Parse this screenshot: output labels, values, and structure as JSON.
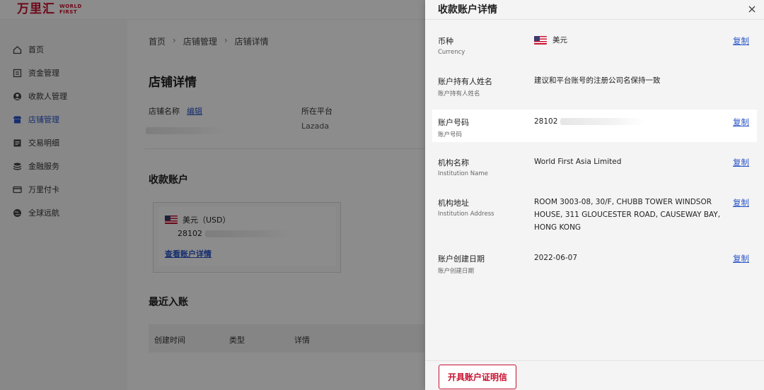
{
  "logo": {
    "cn": "万里汇",
    "en_line1": "WORLD",
    "en_line2": "FIRST"
  },
  "sidebar": {
    "items": [
      {
        "label": "首页",
        "icon": "home-icon",
        "active": false
      },
      {
        "label": "资金管理",
        "icon": "fund-icon",
        "active": false
      },
      {
        "label": "收款人管理",
        "icon": "payee-icon",
        "active": false
      },
      {
        "label": "店铺管理",
        "icon": "store-icon",
        "active": true
      },
      {
        "label": "交易明细",
        "icon": "transactions-icon",
        "active": false
      },
      {
        "label": "金融服务",
        "icon": "finance-icon",
        "active": false
      },
      {
        "label": "万里付卡",
        "icon": "card-icon",
        "active": false
      },
      {
        "label": "全球远航",
        "icon": "globe-icon",
        "active": false
      }
    ]
  },
  "breadcrumb": {
    "items": [
      "首页",
      "店铺管理",
      "店铺详情"
    ],
    "separator": "›"
  },
  "store": {
    "title": "店铺详情",
    "name_label": "店铺名称",
    "edit_link": "编辑",
    "platform_label": "所在平台",
    "platform_value": "Lazada"
  },
  "receiving": {
    "title": "收款账户",
    "currency": "美元（USD）",
    "account_prefix": "28102",
    "view_link": "查看账户详情"
  },
  "recent": {
    "title": "最近入账",
    "columns": [
      "创建时间",
      "类型",
      "详情"
    ]
  },
  "drawer": {
    "title": "收款账户详情",
    "rows": [
      {
        "label": "币种",
        "sub": "Currency",
        "value": "美元",
        "flag": true,
        "copy": "复制"
      },
      {
        "label": "账户持有人姓名",
        "sub": "账户持有人姓名",
        "value": "建议和平台账号的注册公司名保持一致",
        "flag": false,
        "copy": ""
      },
      {
        "label": "账户号码",
        "sub": "账户号码",
        "value": "28102",
        "flag": false,
        "copy": "复制",
        "highlight": true
      },
      {
        "label": "机构名称",
        "sub": "Institution Name",
        "value": "World First Asia Limited",
        "flag": false,
        "copy": "复制"
      },
      {
        "label": "机构地址",
        "sub": "Institution Address",
        "value_lines": [
          "ROOM 3003-08, 30/F, CHUBB TOWER WINDSOR",
          "HOUSE, 311 GLOUCESTER ROAD, CAUSEWAY BAY,",
          "HONG KONG"
        ],
        "flag": false,
        "copy": "复制"
      },
      {
        "label": "账户创建日期",
        "sub": "账户创建日期",
        "value": "2022-06-07",
        "flag": false,
        "copy": "复制"
      }
    ],
    "footer_button": "开具账户证明信"
  },
  "colors": {
    "brand": "#c8102e",
    "link": "#2a55c8",
    "overlay": "rgba(0,0,0,0.45)"
  }
}
